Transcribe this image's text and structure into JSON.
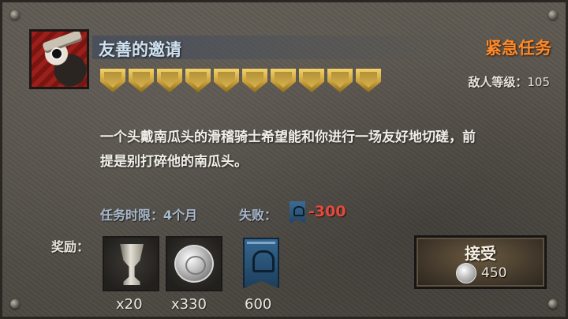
{
  "quest": {
    "title": "友善的邀请",
    "urgency": "紧急任务",
    "difficulty_shields": 10,
    "enemy_level_label": "敌人等级：",
    "enemy_level_value": "105",
    "description_line1": "一个头戴南瓜头的滑稽骑士希望能和你进行一场友好地切磋，前",
    "description_line2": "提是别打碎他的南瓜头。",
    "time_limit": "任务时限：4个月",
    "failure_label": "失败：",
    "failure_value": "-300"
  },
  "rewards": {
    "label": "奖励：",
    "items": [
      {
        "icon": "chalice-icon",
        "count": "x20"
      },
      {
        "icon": "silver-coin-icon",
        "count": "x330"
      },
      {
        "icon": "banner-icon",
        "count": "600"
      }
    ]
  },
  "accept_button": {
    "label": "接受",
    "cost": "450",
    "cost_icon": "silver-coin-icon"
  },
  "colors": {
    "title": "#cfe2f2",
    "urgent": "#ff8a2a",
    "failure_value": "#e04b3e",
    "shield_gold": "#f4d36a"
  }
}
